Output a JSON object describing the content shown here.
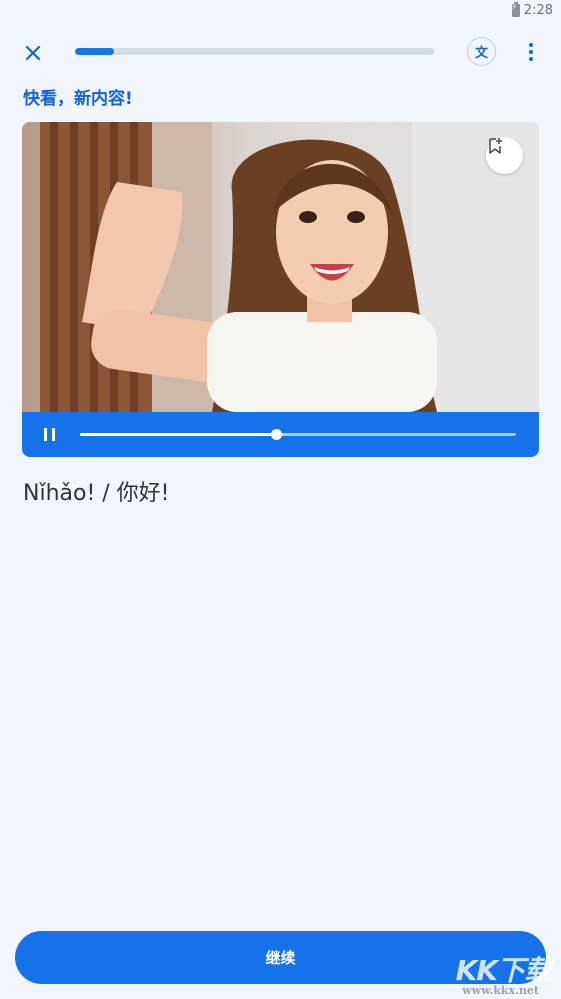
{
  "status_bar": {
    "time": "2:28"
  },
  "lesson": {
    "progress": 0.11
  },
  "header": {
    "translate_label": "文"
  },
  "heading": "快看，新内容!",
  "video": {
    "playback_progress": 0.45
  },
  "phrase": "Nǐhǎo! / 你好!",
  "continue_label": "继续",
  "watermark": {
    "logo": "KK下载",
    "url": "www.kkx.net"
  },
  "colors": {
    "accent": "#1672e9",
    "background": "#f1f6fd",
    "heading": "#1663d6"
  }
}
